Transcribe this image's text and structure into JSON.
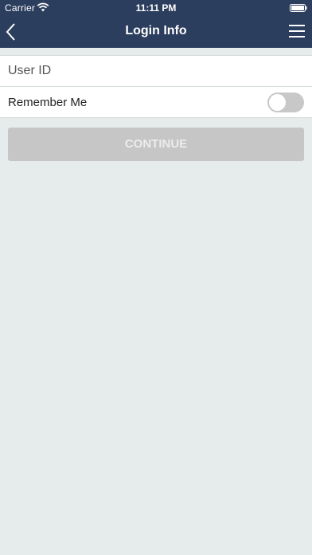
{
  "status_bar": {
    "carrier": "Carrier",
    "time": "11:11 PM",
    "wifi_icon": "wifi-icon",
    "battery_icon": "battery-icon"
  },
  "nav": {
    "title": "Login Info",
    "back_icon": "chevron-left-icon",
    "menu_icon": "hamburger-menu-icon"
  },
  "form": {
    "user_id": {
      "value": "",
      "placeholder": "User ID"
    },
    "remember_me": {
      "label": "Remember Me",
      "checked": false
    }
  },
  "actions": {
    "continue_label": "CONTINUE",
    "continue_enabled": false
  },
  "colors": {
    "header_background": "#2c3e5e",
    "page_background": "#e6ecec",
    "disabled_button": "#c6c6c6",
    "toggle_off": "#c8c8c8"
  }
}
